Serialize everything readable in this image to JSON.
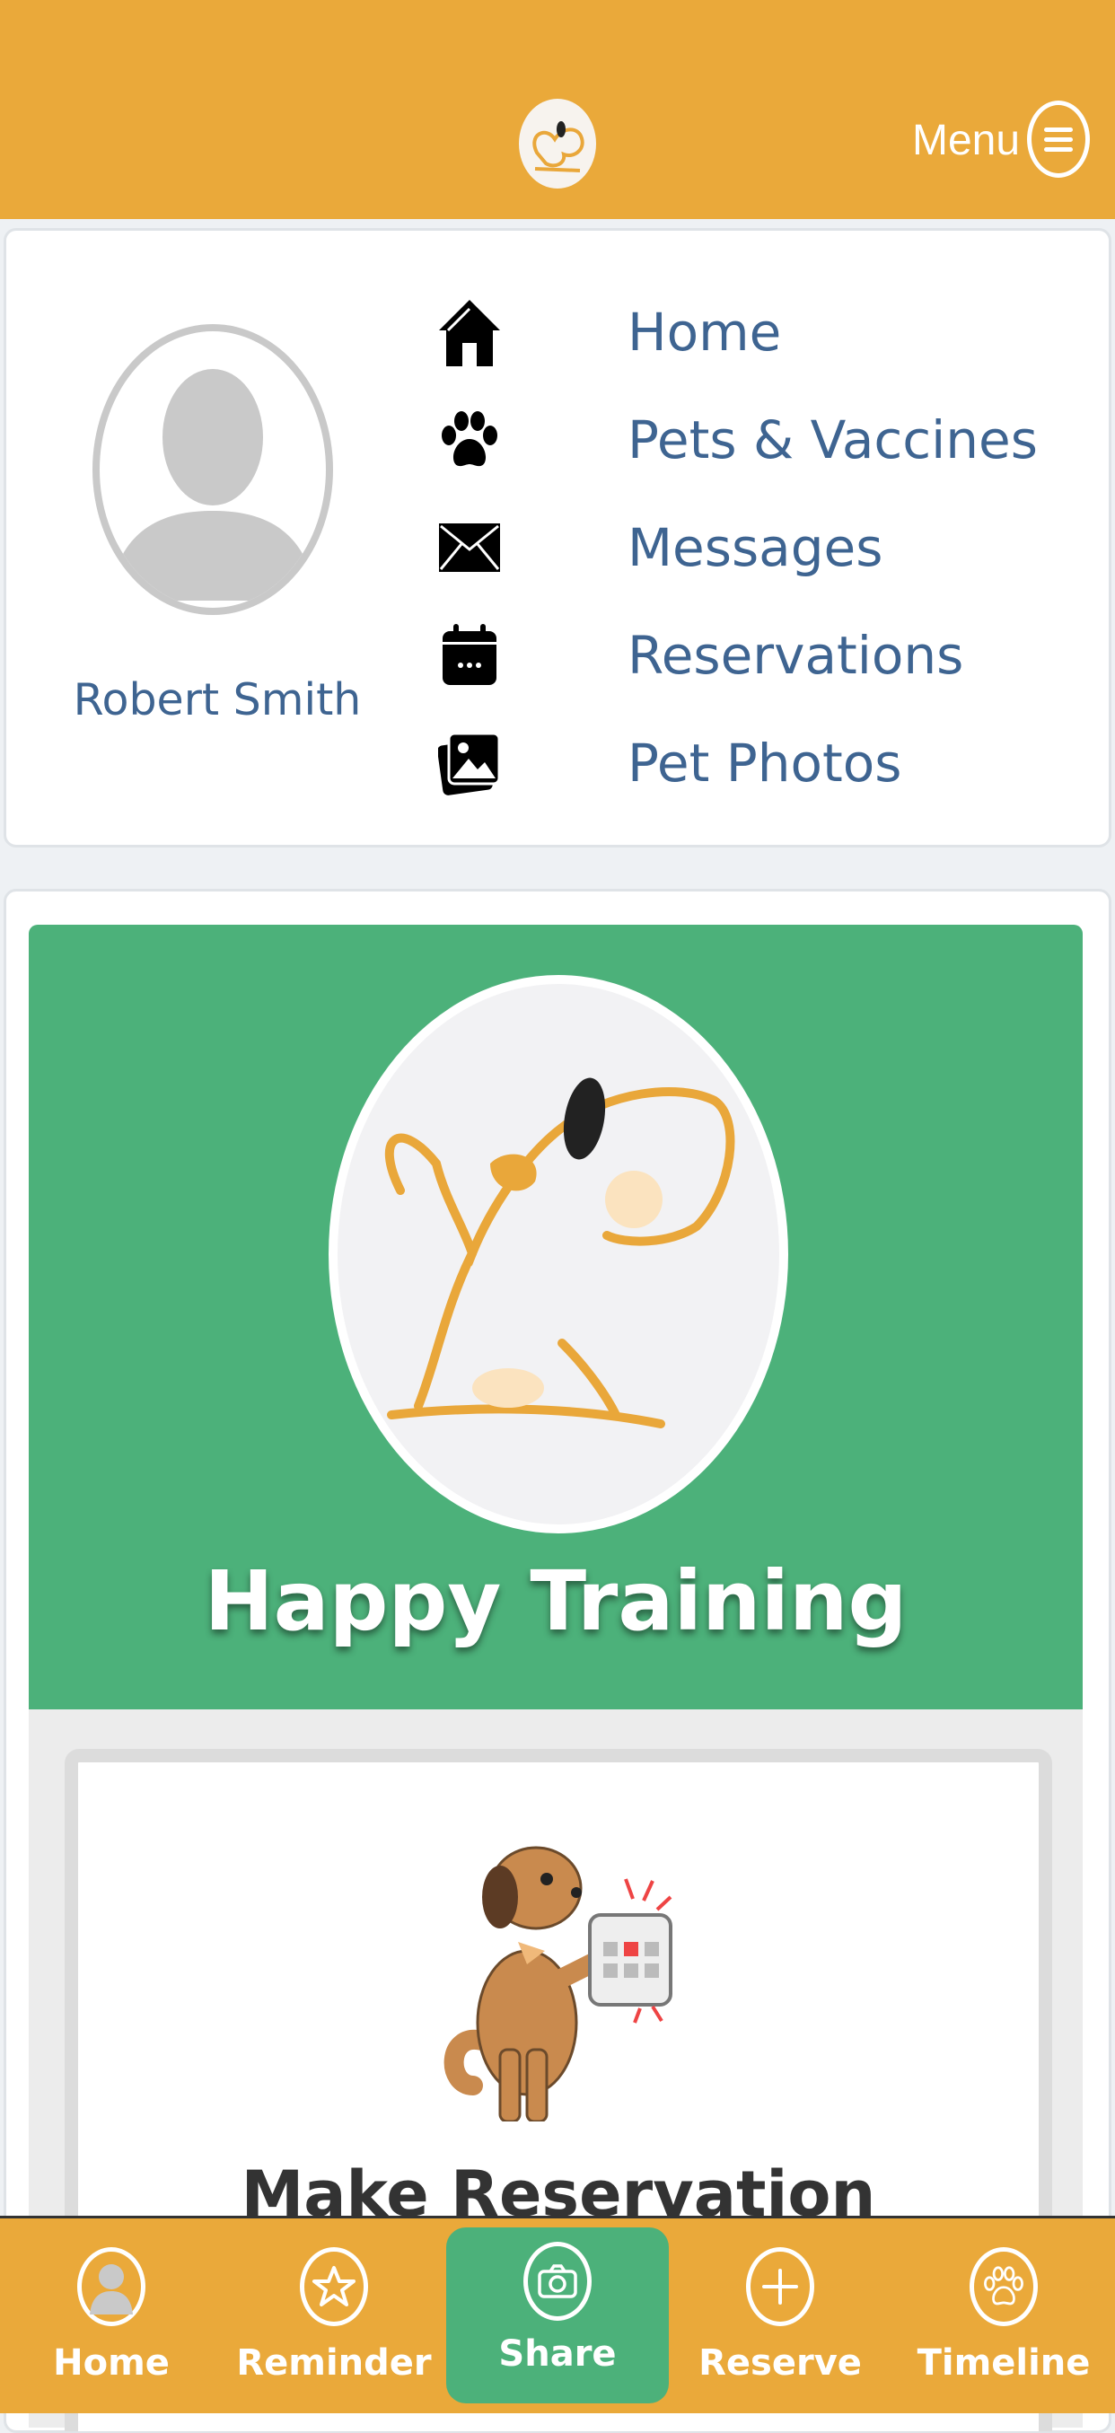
{
  "header": {
    "menu_label": "Menu"
  },
  "profile": {
    "user_name": "Robert Smith"
  },
  "nav": {
    "items": [
      {
        "label": "Home",
        "icon": "home-icon"
      },
      {
        "label": "Pets & Vaccines",
        "icon": "paw-icon"
      },
      {
        "label": "Messages",
        "icon": "envelope-icon"
      },
      {
        "label": "Reservations",
        "icon": "calendar-icon"
      },
      {
        "label": "Pet Photos",
        "icon": "photos-icon"
      }
    ]
  },
  "hero": {
    "title": "Happy Training"
  },
  "reservation_card": {
    "title": "Make Reservation"
  },
  "bottom_nav": {
    "tabs": [
      {
        "label": "Home",
        "icon": "user-icon"
      },
      {
        "label": "Reminder",
        "icon": "star-icon"
      },
      {
        "label": "Share",
        "icon": "camera-icon",
        "active": true
      },
      {
        "label": "Reserve",
        "icon": "plus-icon"
      },
      {
        "label": "Timeline",
        "icon": "paw-icon"
      }
    ]
  },
  "colors": {
    "header": "#eaa93a",
    "accent_green": "#4cb17a",
    "link_blue": "#3e6491"
  }
}
